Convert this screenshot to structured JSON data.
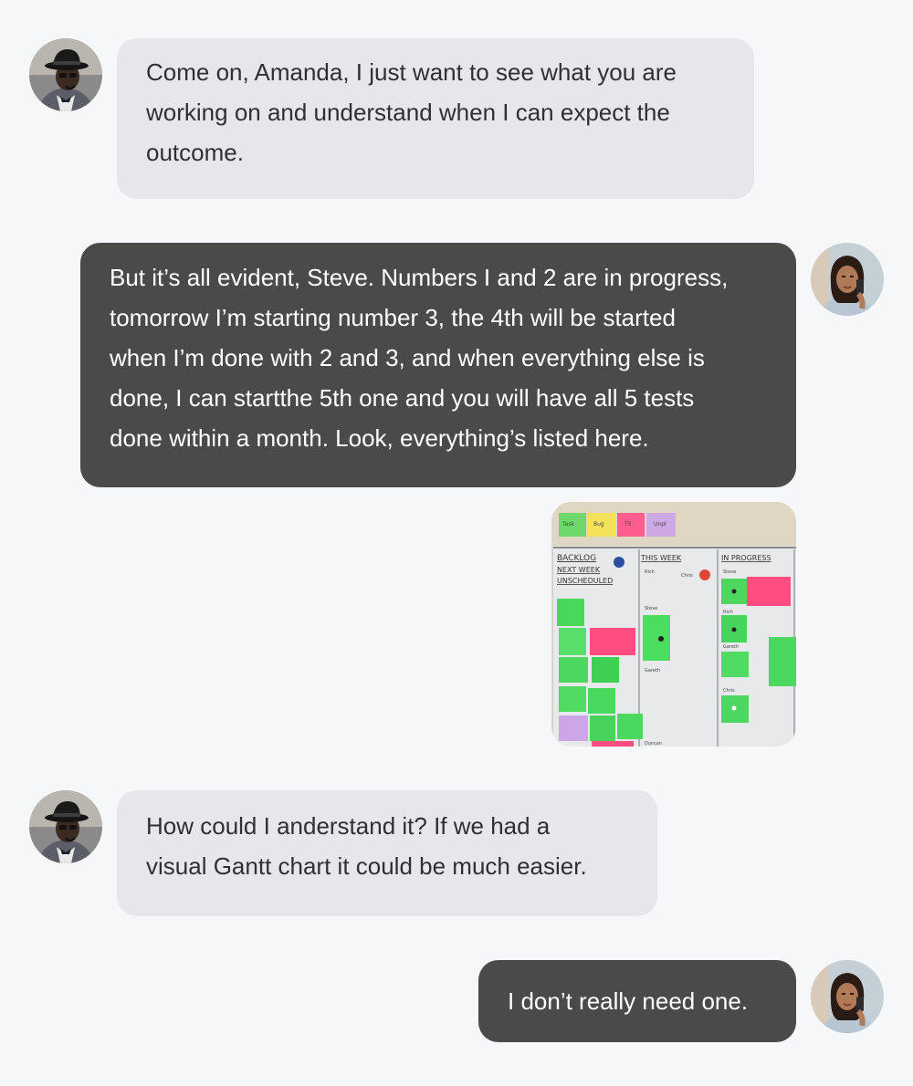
{
  "messages": [
    {
      "sender": "Steve",
      "side": "incoming",
      "lines": [
        "Come on, Amanda, I just want to see what you are",
        "working on and understand when I can expect the",
        "outcome."
      ]
    },
    {
      "sender": "Amanda",
      "side": "outgoing",
      "lines": [
        "But it’s all evident, Steve. Numbers I and 2 are in progress,",
        "tomorrow I’m starting number 3, the 4th will be started",
        "when I’m done with 2 and 3, and when everything else is",
        "done, I can startthe 5th one and you will have all 5 tests",
        "done within a month. Look, everything’s listed here."
      ]
    },
    {
      "sender": "Amanda",
      "side": "outgoing",
      "attachment": {
        "type": "photo",
        "icon": "kanban-board-photo",
        "column_headers": [
          "BACKLOG",
          "THIS WEEK",
          "IN PROGRESS"
        ],
        "backlog_sublabels": [
          "NEXT WEEK",
          "UNSCHEDULED"
        ],
        "names": [
          "Rich",
          "Chris",
          "Steve",
          "Steve",
          "Rich",
          "Gareth",
          "Gareth",
          "Chris",
          "Duncan"
        ],
        "top_tabs": [
          "Task",
          "Bug",
          "TS",
          "Unpl"
        ]
      }
    },
    {
      "sender": "Steve",
      "side": "incoming",
      "lines": [
        "How could I anderstand it? If we had a",
        "visual Gantt chart it could be much easier."
      ]
    },
    {
      "sender": "Amanda",
      "side": "outgoing",
      "lines": [
        "I don’t really need one."
      ]
    }
  ],
  "avatars": {
    "steve": {
      "icon": "man-with-hat-avatar"
    },
    "amanda": {
      "icon": "woman-on-phone-avatar"
    }
  },
  "colors": {
    "background": "#f6f7f9",
    "incoming_bubble": "#e5e7eb",
    "incoming_text": "#2e3035",
    "outgoing_bubble": "#4a4a4a",
    "outgoing_text": "#ffffff"
  }
}
